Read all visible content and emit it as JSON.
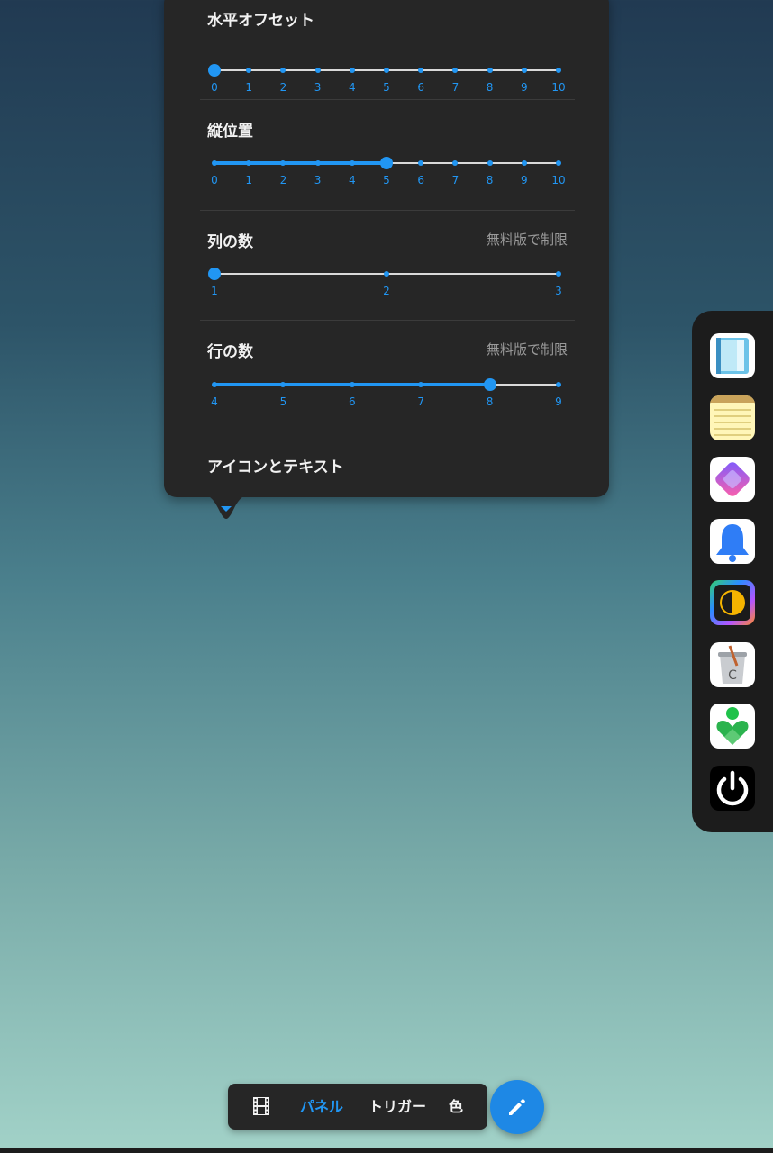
{
  "settings": {
    "horizontal_offset": {
      "title": "水平オフセット",
      "ticks": [
        "0",
        "1",
        "2",
        "3",
        "4",
        "5",
        "6",
        "7",
        "8",
        "9",
        "10"
      ],
      "value": 0
    },
    "vertical_position": {
      "title": "縦位置",
      "ticks": [
        "0",
        "1",
        "2",
        "3",
        "4",
        "5",
        "6",
        "7",
        "8",
        "9",
        "10"
      ],
      "value": 5
    },
    "columns": {
      "title": "列の数",
      "note": "無料版で制限",
      "ticks": [
        "1",
        "2",
        "3"
      ],
      "value": 1
    },
    "rows": {
      "title": "行の数",
      "note": "無料版で制限",
      "ticks": [
        "4",
        "5",
        "6",
        "7",
        "8",
        "9"
      ],
      "value": 8
    },
    "icon_text": {
      "title": "アイコンとテキスト"
    }
  },
  "dock": {
    "apps": [
      "notebook-app-icon",
      "notepad-app-icon",
      "shortcuts-app-icon",
      "notification-bell-app-icon",
      "contrast-app-icon",
      "cleaner-app-icon",
      "heart-location-app-icon",
      "power-app-icon"
    ]
  },
  "toolbar": {
    "film_icon": "film-icon",
    "tab_panel": "パネル",
    "tab_trigger": "トリガー",
    "tab_color": "色",
    "edit_icon": "pencil-icon"
  },
  "colors": {
    "accent": "#2196f3",
    "panel": "#262626"
  }
}
